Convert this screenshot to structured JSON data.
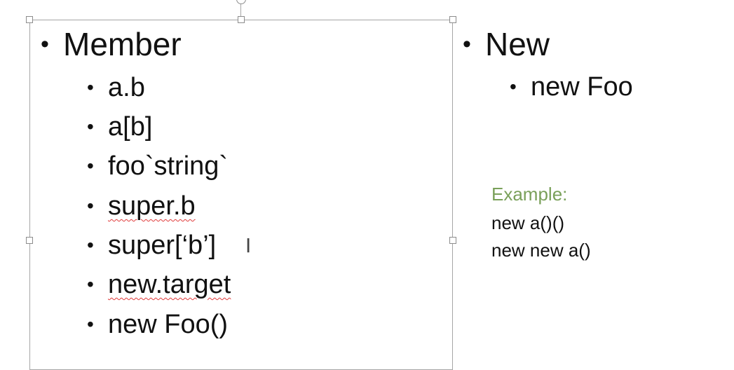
{
  "left_box": {
    "heading": "Member",
    "items": [
      {
        "label": "a.b",
        "spellcheck": false
      },
      {
        "label": "a[b]",
        "spellcheck": false
      },
      {
        "label": "foo`string`",
        "spellcheck": false
      },
      {
        "label": "super.b",
        "spellcheck": true
      },
      {
        "label": "super[‘b’]",
        "spellcheck": false
      },
      {
        "label": "new.target",
        "spellcheck": true
      },
      {
        "label": "new Foo()",
        "spellcheck": false
      }
    ]
  },
  "right_column": {
    "heading": "New",
    "items": [
      {
        "label": "new Foo"
      }
    ],
    "example": {
      "label": "Example:",
      "lines": [
        "new a()()",
        "new new a()"
      ]
    }
  },
  "colors": {
    "example_label": "#7aa05a",
    "spellcheck_underline": "#e03b3b",
    "selection_border": "#a6a6a6"
  },
  "cursor": "text-ibeam-cursor-icon"
}
